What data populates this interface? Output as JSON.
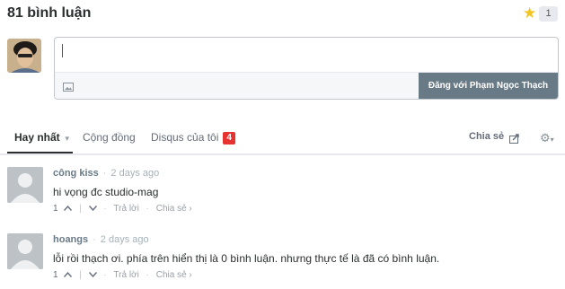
{
  "header": {
    "title": "81 bình luận",
    "star_count": "1"
  },
  "composer": {
    "post_button": "Đăng với Phạm Ngọc Thạch"
  },
  "tabs": [
    {
      "label": "Hay nhất"
    },
    {
      "label": "Cộng đồng"
    },
    {
      "label": "Disqus của tôi",
      "badge": "4"
    }
  ],
  "share": {
    "label": "Chia sẻ"
  },
  "comments": [
    {
      "author": "công kiss",
      "time": "2 days ago",
      "text": "hi vọng đc studio-mag",
      "votes": "1",
      "reply": "Trả lời",
      "share": "Chia sẻ ›"
    },
    {
      "author": "hoangs",
      "time": "2 days ago",
      "text": "lỗi rồi thạch ơi. phía trên hiển thị là 0 bình luận. nhưng thực tế là đã có bình luận.",
      "votes": "1",
      "reply": "Trả lời",
      "share": "Chia sẻ ›"
    }
  ],
  "colors": {
    "accent": "#e63231",
    "star": "#f3c31f",
    "button": "#687a86"
  }
}
